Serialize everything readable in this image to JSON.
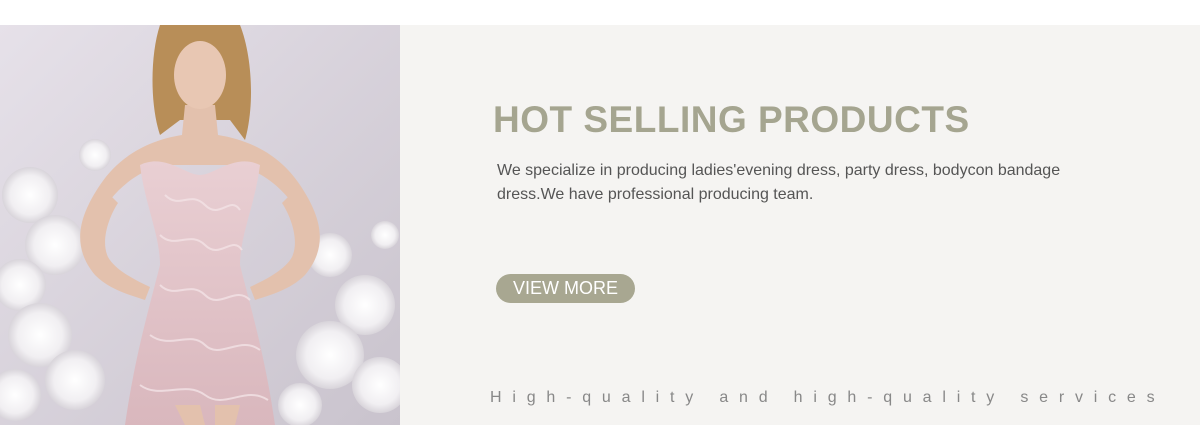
{
  "banner": {
    "image": {
      "alt": "Model in pink lace strapless mini dress with white paper flowers"
    },
    "headline": "HOT SELLING PRODUCTS",
    "description": "We specialize in producing ladies'evening dress, party dress, bodycon bandage dress.We have professional producing team.",
    "button_label": "VIEW MORE",
    "tagline": "High-quality and high-quality services",
    "colors": {
      "accent": "#a5a590",
      "panel_background": "#f5f4f2",
      "button_text": "#ffffff"
    }
  }
}
